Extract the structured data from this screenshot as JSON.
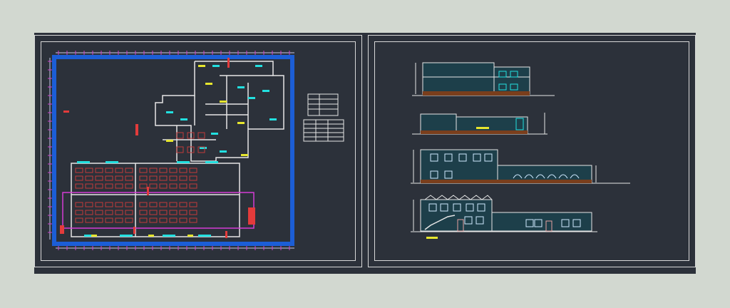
{
  "colors": {
    "background": "#d2d8d0",
    "modelspace": "#2c313a",
    "frame": "#d8d8d8",
    "boundary": "#1c5ed6",
    "walls": "#e6e6e6",
    "furniture": "#e33b3b",
    "cyan": "#22e0e0",
    "yellow": "#e6e62e",
    "magenta": "#d43cd4",
    "ground": "#7a3e1c",
    "facade": "#1d3f4a"
  },
  "icons": {
    "tag": "red-tag-icon",
    "stair": "stair-icon"
  }
}
